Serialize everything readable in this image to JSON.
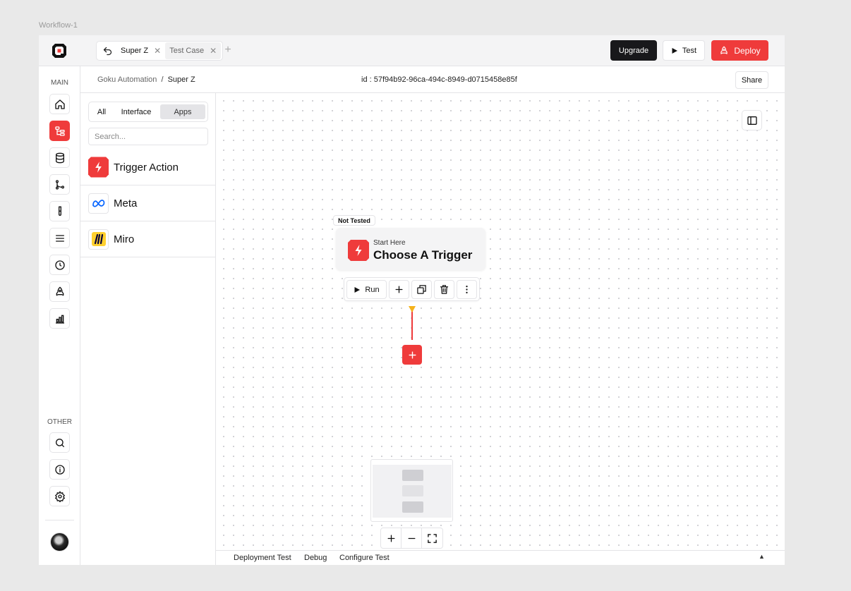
{
  "frame_label": "Workflow-1",
  "topbar": {
    "tabs": [
      {
        "label": "Super Z",
        "active": true
      },
      {
        "label": "Test Case",
        "active": false
      }
    ],
    "upgrade_label": "Upgrade",
    "test_label": "Test",
    "deploy_label": "Deploy"
  },
  "rail": {
    "main_label": "MAIN",
    "other_label": "OTHER",
    "main_items": [
      "home-icon",
      "workflow-icon",
      "database-icon",
      "git-branch-icon",
      "test-tube-icon",
      "list-icon",
      "clock-icon",
      "rocket-icon",
      "bar-chart-icon"
    ],
    "other_items": [
      "search-icon",
      "info-icon",
      "settings-icon"
    ]
  },
  "breadcrumb": {
    "parent": "Goku Automation",
    "separator": "/",
    "current": "Super Z"
  },
  "workflow_id": "id : 57f94b92-96ca-494c-8949-d0715458e85f",
  "share_label": "Share",
  "panel": {
    "filters": [
      "All",
      "Interface",
      "Apps"
    ],
    "selected_filter": "Apps",
    "search_placeholder": "Search...",
    "apps": [
      {
        "name": "Trigger Action",
        "icon": "lightning-icon"
      },
      {
        "name": "Meta",
        "icon": "meta-logo-icon"
      },
      {
        "name": "Miro",
        "icon": "miro-logo-icon"
      }
    ]
  },
  "canvas": {
    "node_status": "Not Tested",
    "node_subtitle": "Start Here",
    "node_title": "Choose A Trigger",
    "run_label": "Run"
  },
  "bottombar": {
    "tabs": [
      "Deployment Test",
      "Debug",
      "Configure Test"
    ]
  },
  "colors": {
    "accent": "#ef3b3b",
    "dark": "#18181b",
    "connector_tip": "#f5b21b"
  }
}
